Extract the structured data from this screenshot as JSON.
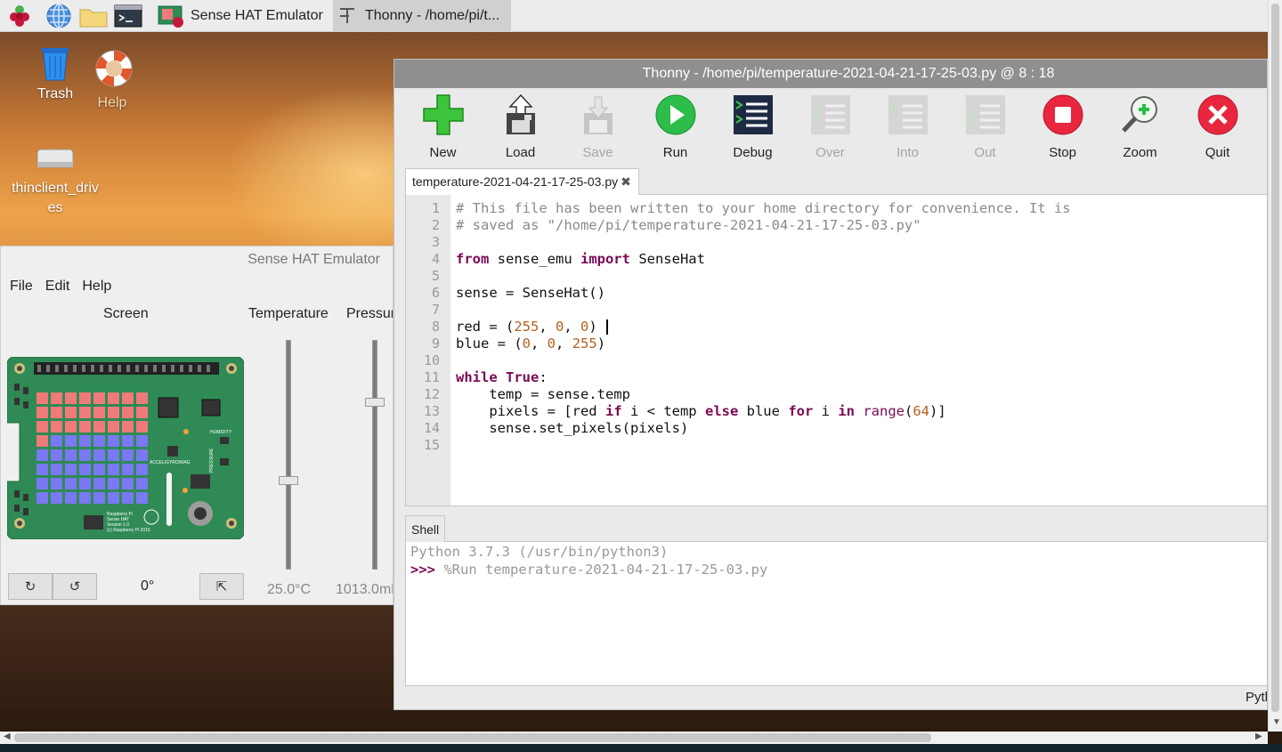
{
  "taskbar": {
    "tasks": [
      {
        "label": "Sense HAT Emulator"
      },
      {
        "label": "Thonny  -  /home/pi/t..."
      }
    ]
  },
  "desktop": {
    "icons": [
      {
        "label": "Trash",
        "icon": "trash-icon"
      },
      {
        "label": "Help",
        "icon": "help-lifebuoy-icon"
      },
      {
        "label": "thinclient_drives",
        "icon": "drive-icon"
      }
    ]
  },
  "thonny": {
    "title": "Thonny  -  /home/pi/temperature-2021-04-21-17-25-03.py  @  8 : 18",
    "toolbar": [
      {
        "label": "New",
        "enabled": true
      },
      {
        "label": "Load",
        "enabled": true
      },
      {
        "label": "Save",
        "enabled": false
      },
      {
        "label": "Run",
        "enabled": true
      },
      {
        "label": "Debug",
        "enabled": true
      },
      {
        "label": "Over",
        "enabled": false
      },
      {
        "label": "Into",
        "enabled": false
      },
      {
        "label": "Out",
        "enabled": false
      },
      {
        "label": "Stop",
        "enabled": true
      },
      {
        "label": "Zoom",
        "enabled": true
      },
      {
        "label": "Quit",
        "enabled": true
      }
    ],
    "tab_label": "temperature-2021-04-21-17-25-03.py",
    "line_numbers": [
      "1",
      "2",
      "3",
      "4",
      "5",
      "6",
      "7",
      "8",
      "9",
      "10",
      "11",
      "12",
      "13",
      "14",
      "15"
    ],
    "code_lines": [
      "# This file has been written to your home directory for convenience. It is",
      "# saved as \"/home/pi/temperature-2021-04-21-17-25-03.py\"",
      "",
      "from sense_emu import SenseHat",
      "",
      "sense = SenseHat()",
      "",
      "red = (255, 0, 0)",
      "blue = (0, 0, 255)",
      "",
      "while True:",
      "    temp = sense.temp",
      "    pixels = [red if i < temp else blue for i in range(64)]",
      "    sense.set_pixels(pixels)",
      ""
    ],
    "shell_tab": "Shell",
    "shell_lines": {
      "version": "Python 3.7.3 (/usr/bin/python3)",
      "prompt": ">>>",
      "command": "%Run temperature-2021-04-21-17-25-03.py"
    },
    "status_text": "Pytl"
  },
  "sense_hat": {
    "title": "Sense HAT Emulator",
    "menu": [
      "File",
      "Edit",
      "Help"
    ],
    "screen_label": "Screen",
    "temperature_label": "Temperature",
    "pressure_label": "Pressur",
    "rotation_value": "0°",
    "temperature_value": "25.0°C",
    "pressure_value": "1013.0ml",
    "temperature_level": 0.5,
    "pressure_level": 0.73,
    "rotate_right_symbol": "↻",
    "rotate_left_symbol": "↺",
    "orient_symbol": "⇱",
    "board_text": {
      "humidity": "HUMIDITY",
      "accel": "ACCEL/GYRO/MAG",
      "pressure": "PRESSURE",
      "credits": [
        "Raspberry Pi",
        "Sense HAT",
        "Version 1.0",
        "(c) Raspberry Pi 2015"
      ]
    },
    "leds_red_count": 25,
    "colors": {
      "red_led": "#f07a7a",
      "blue_led": "#7a78f2",
      "board": "#2f8a55"
    }
  }
}
